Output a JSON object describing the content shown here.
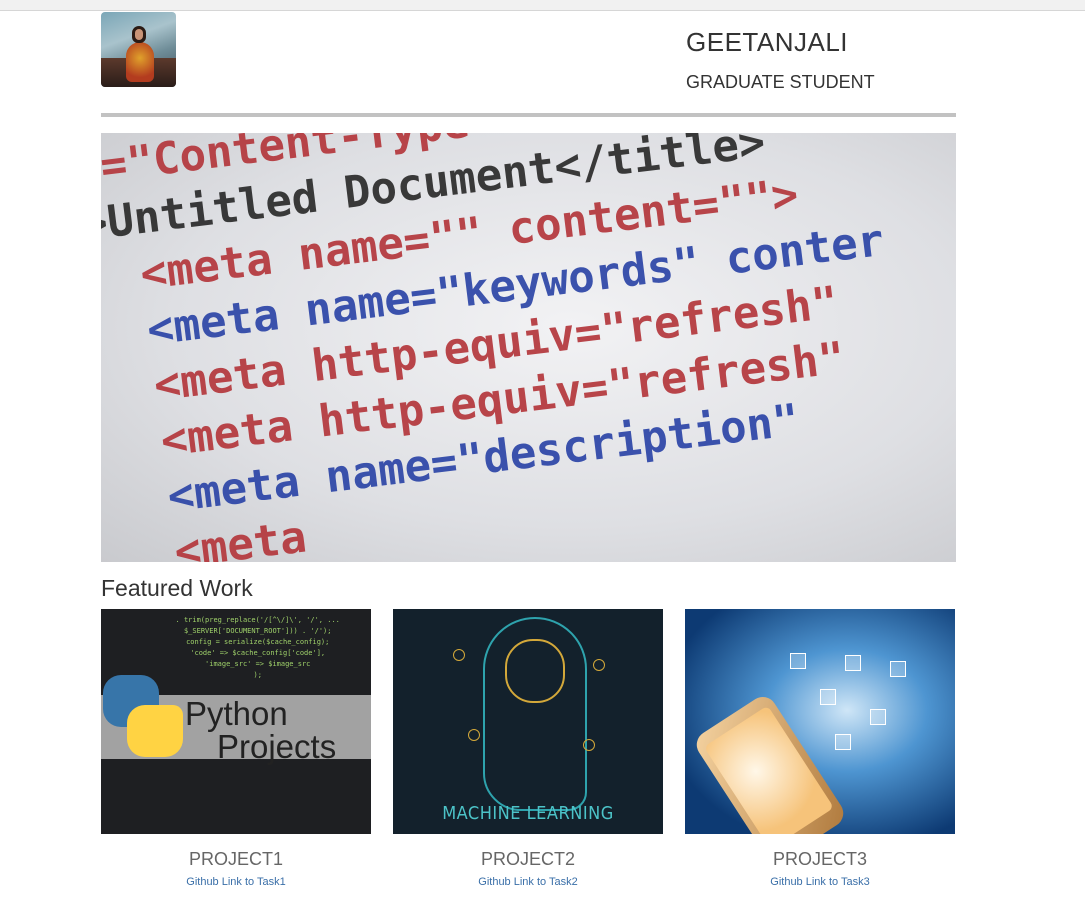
{
  "header": {
    "name": "GEETANJALI",
    "role": "GRADUATE STUDENT"
  },
  "hero": {
    "code_lines": [
      "v=\"Content-Type\" content=\"text/",
      ">Untitled Document</title>",
      "  <meta name=\"\" content=\"\">",
      "  <meta name=\"keywords\" conter",
      "  <meta http-equiv=\"refresh\"",
      "  <meta http-equiv=\"refresh\"",
      "  <meta name=\"description\"",
      "  <meta"
    ]
  },
  "featured": {
    "title": "Featured Work",
    "projects": [
      {
        "title": "PROJECT1",
        "link": "Github Link to Task1",
        "thumb_text_1": "Python",
        "thumb_text_2": "Projects"
      },
      {
        "title": "PROJECT2",
        "link": "Github Link to Task2",
        "thumb_text": "MACHINE LEARNING"
      },
      {
        "title": "PROJECT3",
        "link": "Github Link to Task3"
      }
    ]
  },
  "colors": {
    "divider": "#c2c2c2",
    "link": "#3a6fa8",
    "heading": "#333333",
    "project_title": "#666666"
  }
}
